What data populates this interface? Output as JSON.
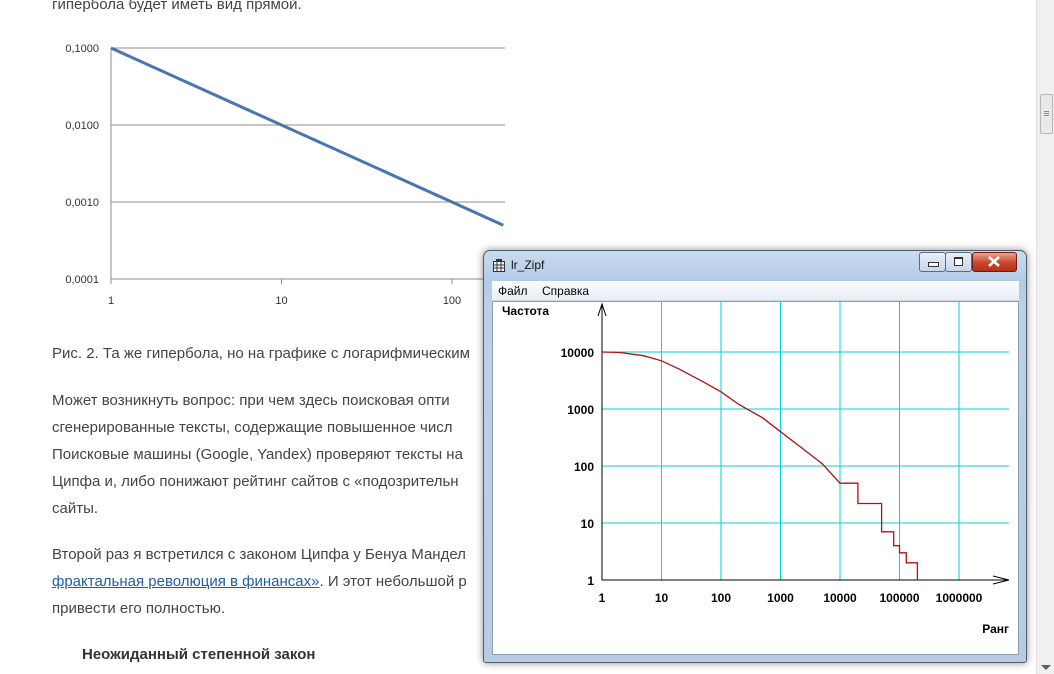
{
  "article": {
    "top_fragment": "гипербола будет иметь вид прямой.",
    "chart1": {
      "y_ticks": [
        "0,1000",
        "0,0100",
        "0,0010",
        "0,0001"
      ],
      "x_ticks": [
        "1",
        "10",
        "100"
      ]
    },
    "caption": "Рис. 2. Та же гипербола, но на графике с логарифмическим",
    "para1": [
      "Может возникнуть вопрос: при чем здесь поисковая опти",
      "сгенерированные тексты, содержащие повышенное числ",
      "Поисковые машины (Google, Yandex) проверяют тексты на",
      "Ципфа и, либо понижают рейтинг сайтов с «подозрительн",
      "сайты."
    ],
    "para2_line1": "Второй раз я встретился с законом Ципфа у Бенуа Мандел",
    "para2_link": "фрактальная революция в финансах»",
    "para2_line2_rest": ". И этот небольшой р",
    "para2_line3": "привести его полностью.",
    "subheading": "Неожиданный степенной закон"
  },
  "window": {
    "title": "lr_Zipf",
    "menu": [
      "Файл",
      "Справка"
    ],
    "chart": {
      "y_axis_label": "Частота",
      "x_axis_label": "Ранг",
      "y_ticks": [
        "10000",
        "1000",
        "100",
        "10",
        "1"
      ],
      "x_ticks": [
        "1",
        "10",
        "100",
        "1000",
        "10000",
        "100000",
        "1000000"
      ],
      "grid_color": "#00d6d6",
      "curve_color": "#b01010"
    }
  },
  "chart_data": [
    {
      "type": "line",
      "x_scale": "log",
      "y_scale": "log",
      "xlim": [
        1,
        200
      ],
      "ylim": [
        0.0001,
        0.1
      ],
      "grid": true,
      "series": [
        {
          "x": [
            1,
            200
          ],
          "y": [
            0.1,
            0.0005
          ],
          "color": "#4a76b0"
        }
      ]
    },
    {
      "type": "line",
      "x_scale": "log",
      "y_scale": "log",
      "xlim": [
        1,
        10000000
      ],
      "ylim": [
        1,
        30000
      ],
      "grid": true,
      "xlabel": "Ранг",
      "ylabel": "Частота",
      "series": [
        {
          "x": [
            1,
            2,
            5,
            10,
            20,
            50,
            100,
            200,
            500,
            1000,
            2000,
            5000,
            10000,
            20000,
            50000,
            80000,
            100000,
            130000,
            160000,
            200000
          ],
          "y": [
            10000,
            9800,
            8600,
            7000,
            5000,
            3000,
            2000,
            1200,
            700,
            400,
            230,
            110,
            50,
            22,
            7,
            4,
            3,
            2,
            2,
            1
          ],
          "color": "#b01010"
        }
      ]
    }
  ]
}
